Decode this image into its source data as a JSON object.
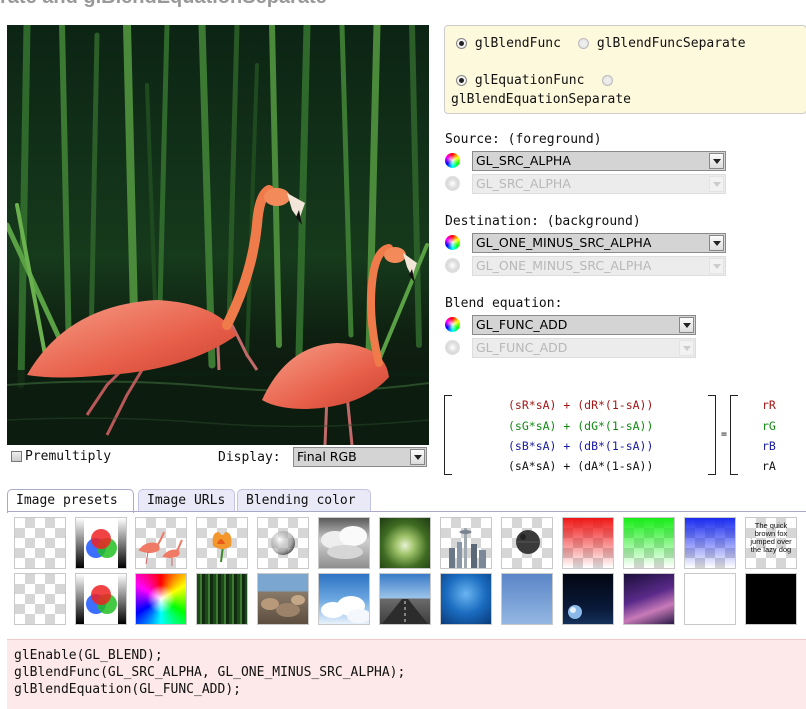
{
  "page": {
    "title": "rate and glBlendEquationSeparate"
  },
  "mode": {
    "func_radio_1": "glBlendFunc",
    "func_radio_2": "glBlendFuncSeparate",
    "eq_radio_1": "glEquationFunc",
    "eq_radio_2": "glBlendEquationSeparate",
    "func_selected": "glBlendFunc",
    "eq_selected": "glEquationFunc"
  },
  "source": {
    "label": "Source: (foreground)",
    "value": "GL_SRC_ALPHA",
    "alpha_value": "GL_SRC_ALPHA"
  },
  "destination": {
    "label": "Destination: (background)",
    "value": "GL_ONE_MINUS_SRC_ALPHA",
    "alpha_value": "GL_ONE_MINUS_SRC_ALPHA"
  },
  "equation": {
    "label": "Blend equation:",
    "value": "GL_FUNC_ADD",
    "alpha_value": "GL_FUNC_ADD"
  },
  "formula": {
    "rows": [
      "(sR*sA) + (dR*(1-sA))",
      "(sG*sA) + (dG*(1-sA))",
      "(sB*sA) + (dB*(1-sA))",
      "(sA*sA) + (dA*(1-sA))"
    ],
    "results": [
      "rR",
      "rG",
      "rB",
      "rA"
    ],
    "equals": "=",
    "colors": [
      "#a01818",
      "#128a12",
      "#1a1aa0",
      "#111111"
    ]
  },
  "options": {
    "premultiply_label": "Premultiply",
    "premultiply_checked": false,
    "display_label": "Display:",
    "display_value": "Final RGB"
  },
  "tabs": [
    {
      "label": "Image presets",
      "active": true
    },
    {
      "label": "Image URLs",
      "active": false
    },
    {
      "label": "Blending color",
      "active": false
    }
  ],
  "presets": {
    "row1": [
      "transparent",
      "rgb-circles",
      "flamingos",
      "tulip",
      "glass-sphere",
      "clouds",
      "forest-canopy",
      "city-skyline",
      "death-star",
      "red-fade",
      "green-fade",
      "blue-fade",
      "text"
    ],
    "row2": [
      "transparent",
      "rgb-circles",
      "color-wheel",
      "reeds",
      "rocks",
      "sky-clouds",
      "road",
      "ocean",
      "blue-haze",
      "earth-space",
      "galaxy",
      "white",
      "black"
    ],
    "text_thumb": "The quick brown fox jumped over the lazy dog"
  },
  "code": [
    "glEnable(GL_BLEND);",
    "glBlendFunc(GL_SRC_ALPHA, GL_ONE_MINUS_SRC_ALPHA);",
    "glBlendEquation(GL_FUNC_ADD);"
  ]
}
